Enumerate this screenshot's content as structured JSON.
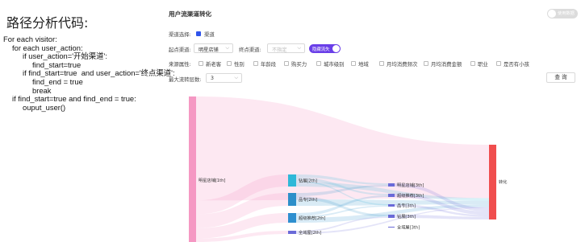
{
  "left": {
    "heading": "路径分析代码:",
    "code_lines": [
      {
        "indent": 0,
        "text": "For each visitor:"
      },
      {
        "indent": 1,
        "text": "for each user_action:"
      },
      {
        "indent": 2,
        "text": "if user_action='开始渠道':"
      },
      {
        "indent": 3,
        "text": "find_start=true"
      },
      {
        "indent": 2,
        "text": "if find_start=true  and user_action='终点渠道':"
      },
      {
        "indent": 3,
        "text": "find_end = true"
      },
      {
        "indent": 3,
        "text": "break"
      },
      {
        "indent": 1,
        "text": "if find_start=true and find_end = true:"
      },
      {
        "indent": 2,
        "text": "ouput_user()"
      }
    ]
  },
  "panel": {
    "title": "用户流渠道转化",
    "toggle_label": "使用数据",
    "channel_select_label": "渠道选择:",
    "channel_option": "渠道",
    "start_channel_label": "起点渠道:",
    "start_channel_value": "明星店铺",
    "end_channel_label": "终点渠道:",
    "end_channel_placeholder": "不指定",
    "hide_loss_label": "隐藏流失",
    "source_attr_label": "来源属性:",
    "attributes": [
      "新老客",
      "性别",
      "年龄段",
      "购买力",
      "城市级别",
      "地域",
      "月均消费频次",
      "月均消费金额",
      "职业",
      "是否有小孩"
    ],
    "max_steps_label": "最大流转层数:",
    "max_steps_value": "3",
    "query_button": "查 询"
  },
  "chart_data": {
    "type": "sankey",
    "nodes": [
      {
        "id": "s0",
        "label": "明星店铺[1th]",
        "color": "#f598c3"
      },
      {
        "id": "a1",
        "label": "钻展[2th]",
        "color": "#2eb8d8"
      },
      {
        "id": "a2",
        "label": "品专[2th]",
        "color": "#2d8fc9"
      },
      {
        "id": "a3",
        "label": "超级推荐[2th]",
        "color": "#2e8fcf"
      },
      {
        "id": "a4",
        "label": "全域屋[2th]",
        "color": "#6a6ad8"
      },
      {
        "id": "b1",
        "label": "明星店铺[3th]",
        "color": "#6a6ad8"
      },
      {
        "id": "b2",
        "label": "超级推荐[3th]",
        "color": "#6a6ad8"
      },
      {
        "id": "b3",
        "label": "品专[3th]",
        "color": "#6a6ad8"
      },
      {
        "id": "b4",
        "label": "钻展[3th]",
        "color": "#6a6ad8"
      },
      {
        "id": "b5",
        "label": "全域屋[3th]",
        "color": "#6a6ad8"
      },
      {
        "id": "c",
        "label": "转化",
        "color": "#f04e4e"
      }
    ],
    "links": [
      {
        "source": "s0",
        "target": "c",
        "value": 60
      },
      {
        "source": "s0",
        "target": "a1",
        "value": 8
      },
      {
        "source": "s0",
        "target": "a2",
        "value": 8
      },
      {
        "source": "s0",
        "target": "a3",
        "value": 6
      },
      {
        "source": "s0",
        "target": "a4",
        "value": 2
      },
      {
        "source": "a1",
        "target": "b1",
        "value": 2
      },
      {
        "source": "a1",
        "target": "b2",
        "value": 2
      },
      {
        "source": "a1",
        "target": "b3",
        "value": 1
      },
      {
        "source": "a1",
        "target": "c",
        "value": 3
      },
      {
        "source": "a2",
        "target": "b1",
        "value": 2
      },
      {
        "source": "a2",
        "target": "b4",
        "value": 2
      },
      {
        "source": "a2",
        "target": "c",
        "value": 4
      },
      {
        "source": "a3",
        "target": "b2",
        "value": 2
      },
      {
        "source": "a3",
        "target": "b3",
        "value": 1
      },
      {
        "source": "a3",
        "target": "c",
        "value": 3
      },
      {
        "source": "a4",
        "target": "b4",
        "value": 1
      },
      {
        "source": "a4",
        "target": "c",
        "value": 1
      },
      {
        "source": "b1",
        "target": "c",
        "value": 4
      },
      {
        "source": "b2",
        "target": "c",
        "value": 4
      },
      {
        "source": "b3",
        "target": "c",
        "value": 2
      },
      {
        "source": "b4",
        "target": "c",
        "value": 3
      }
    ]
  }
}
